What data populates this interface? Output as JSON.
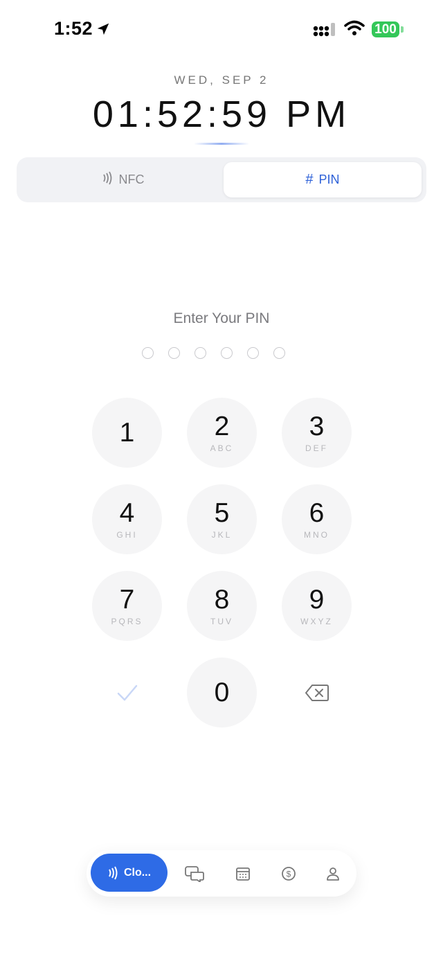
{
  "status_bar": {
    "time": "1:52",
    "battery": "100",
    "icons": [
      "location-arrow-icon",
      "cellular-signal-icon",
      "wifi-icon",
      "battery-icon"
    ],
    "battery_color": "#34c759"
  },
  "clock": {
    "date": "WED, SEP 2",
    "time": "01:52:59 PM"
  },
  "mode_selector": {
    "nfc_label": "NFC",
    "pin_label": "PIN",
    "selected": "PIN",
    "accent_color": "#2f62d8"
  },
  "pin_entry": {
    "title": "Enter Your PIN",
    "digits_total": 6,
    "digits_entered": 0
  },
  "keypad": {
    "keys": [
      {
        "num": "1",
        "letters": ""
      },
      {
        "num": "2",
        "letters": "ABC"
      },
      {
        "num": "3",
        "letters": "DEF"
      },
      {
        "num": "4",
        "letters": "GHI"
      },
      {
        "num": "5",
        "letters": "JKL"
      },
      {
        "num": "6",
        "letters": "MNO"
      },
      {
        "num": "7",
        "letters": "PQRS"
      },
      {
        "num": "8",
        "letters": "TUV"
      },
      {
        "num": "9",
        "letters": "WXYZ"
      },
      {
        "num": "0",
        "letters": ""
      }
    ],
    "confirm_icon": "checkmark-icon",
    "delete_icon": "backspace-icon"
  },
  "tab_bar": {
    "active_label": "Clo...",
    "tabs": [
      "clock-in-nfc-icon",
      "chat-icon",
      "calendar-icon",
      "dollar-icon",
      "person-icon"
    ],
    "active_color": "#2e6be6"
  }
}
